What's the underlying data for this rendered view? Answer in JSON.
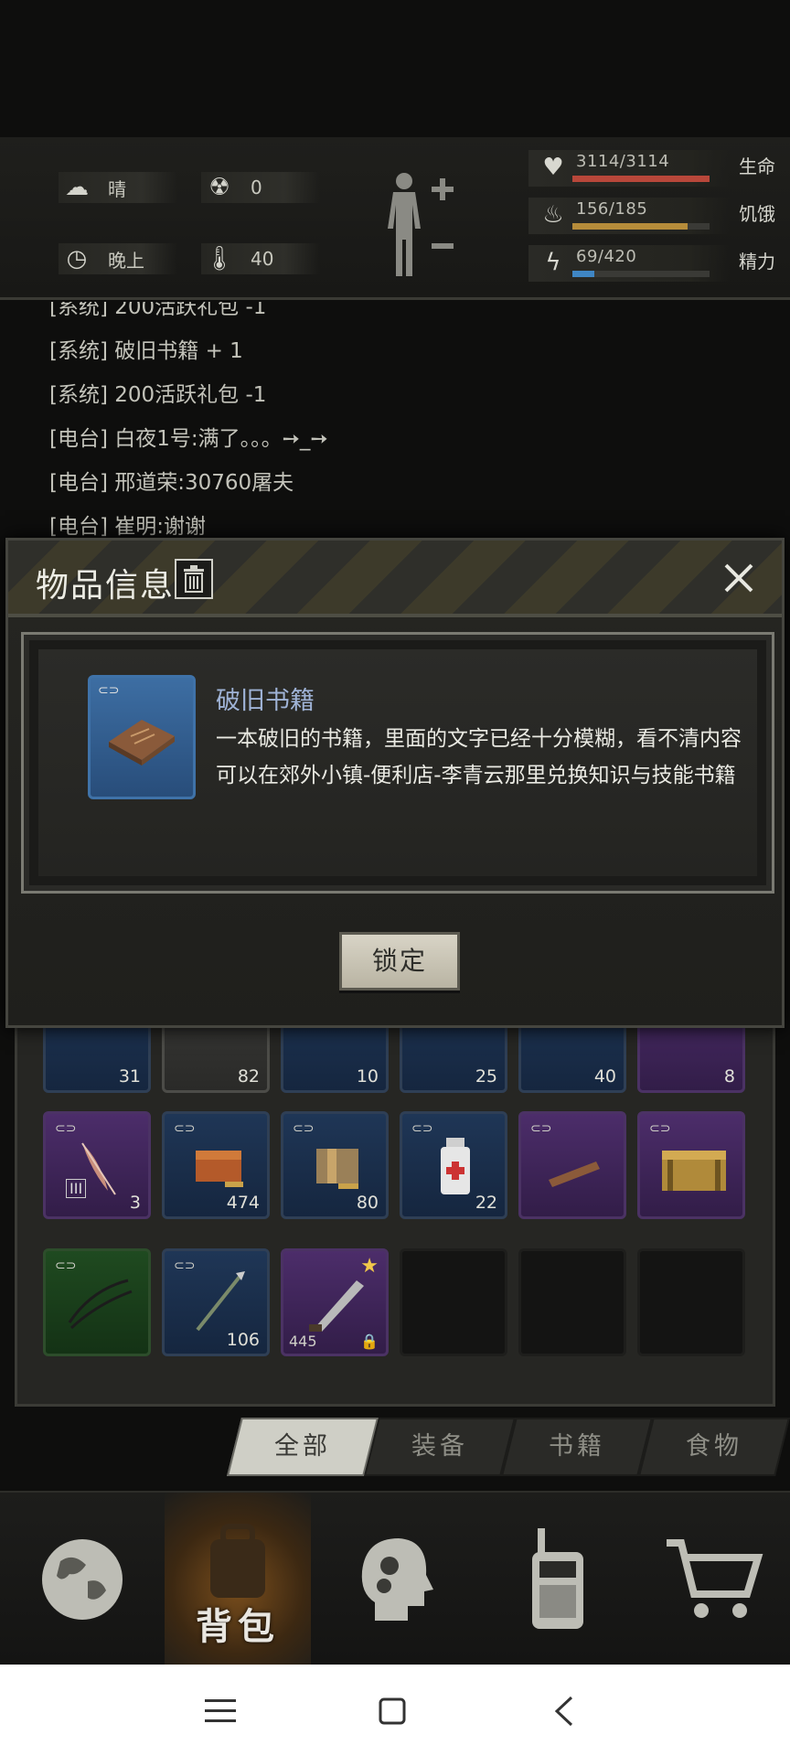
{
  "status": {
    "weather_label": "晴",
    "weather_icon": "cloud-sun-icon",
    "radiation_value": "0",
    "radiation_icon": "radiation-icon",
    "time_label": "晚上",
    "time_icon": "clock-icon",
    "temperature_value": "40",
    "temperature_icon": "thermometer-icon"
  },
  "stats": [
    {
      "icon": "heart-icon",
      "value": "3114/3114",
      "label": "生命",
      "fraction": 1.0,
      "color": "#b8473a"
    },
    {
      "icon": "stomach-icon",
      "value": "156/185",
      "label": "饥饿",
      "fraction": 0.84,
      "color": "#b68c3a"
    },
    {
      "icon": "energy-icon",
      "value": "69/420",
      "label": "精力",
      "fraction": 0.16,
      "color": "#3f86c4"
    }
  ],
  "log": [
    "[系统] 200活跃礼包 -1",
    "[系统] 破旧书籍 + 1",
    "[系统] 200活跃礼包 -1",
    "[电台] 白夜1号:满了。。。➙_➙",
    "[电台] 邢道荣:30760屠夫",
    "[电台] 崔明:谢谢"
  ],
  "modal": {
    "title": "物品信息",
    "item_name": "破旧书籍",
    "desc_line1": "一本破旧的书籍，里面的文字已经十分模糊，看不清内容",
    "desc_line2": "可以在郊外小镇-便利店-李青云那里兑换知识与技能书籍",
    "lock_label": "锁定"
  },
  "inventory": {
    "row1": [
      {
        "count": "31",
        "rarity": "blue"
      },
      {
        "count": "82",
        "rarity": "grey"
      },
      {
        "count": "10",
        "rarity": "blue"
      },
      {
        "count": "25",
        "rarity": "blue"
      },
      {
        "count": "40",
        "rarity": "blue"
      },
      {
        "count": "8",
        "rarity": "purple"
      }
    ],
    "row2": [
      {
        "count": "3",
        "rarity": "purple",
        "badge": "III"
      },
      {
        "count": "474",
        "rarity": "blue"
      },
      {
        "count": "80",
        "rarity": "blue"
      },
      {
        "count": "22",
        "rarity": "blue"
      },
      {
        "count": "",
        "rarity": "purple"
      },
      {
        "count": "",
        "rarity": "purple"
      }
    ],
    "row3": [
      {
        "count": "",
        "rarity": "green"
      },
      {
        "count": "106",
        "rarity": "blue"
      },
      {
        "count": "445",
        "rarity": "purple"
      }
    ]
  },
  "tabs": [
    "全部",
    "装备",
    "书籍",
    "食物"
  ],
  "nav": {
    "active_label": "背包"
  }
}
